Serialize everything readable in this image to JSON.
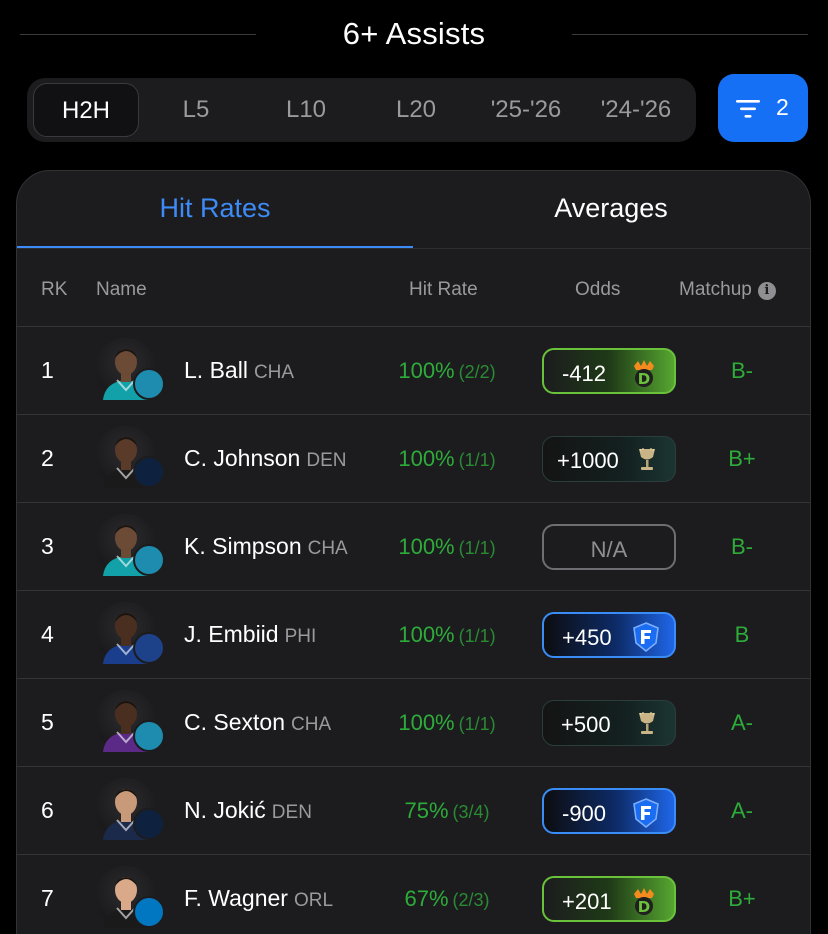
{
  "header": {
    "title": "6+ Assists"
  },
  "periods": [
    {
      "label": "H2H",
      "active": true
    },
    {
      "label": "L5",
      "active": false
    },
    {
      "label": "L10",
      "active": false
    },
    {
      "label": "L20",
      "active": false
    },
    {
      "label": "'25-'26",
      "active": false
    },
    {
      "label": "'24-'26",
      "active": false
    }
  ],
  "filter": {
    "count": "2",
    "icon": "filter-icon"
  },
  "tabs": {
    "hit_rates": "Hit Rates",
    "averages": "Averages",
    "active": "hit_rates"
  },
  "columns": {
    "rk": "RK",
    "name": "Name",
    "hit_rate": "Hit Rate",
    "odds": "Odds",
    "matchup": "Matchup",
    "matchup_icon": "info-icon"
  },
  "colors": {
    "accent": "#1670f5",
    "tab_active": "#3d8bf7",
    "positive": "#2dac3a",
    "draftkings": "#56a631",
    "fanduel": "#1f66e8"
  },
  "players": [
    {
      "rank": "1",
      "name": "L. Ball",
      "team": "CHA",
      "hit_pct": "100%",
      "hit_frac": "(2/2)",
      "odds": "-412",
      "book": "dk",
      "book_icon": "draftkings-icon",
      "matchup": "B-",
      "jersey": "#12a1a8",
      "skin": "#6b4a36",
      "team_color": "#1d8caf"
    },
    {
      "rank": "2",
      "name": "C. Johnson",
      "team": "DEN",
      "hit_pct": "100%",
      "hit_frac": "(1/1)",
      "odds": "+1000",
      "book": "cz",
      "book_icon": "caesars-chalice-icon",
      "matchup": "B+",
      "jersey": "#1a1a1a",
      "skin": "#5a3a28",
      "team_color": "#0e2240"
    },
    {
      "rank": "3",
      "name": "K. Simpson",
      "team": "CHA",
      "hit_pct": "100%",
      "hit_frac": "(1/1)",
      "odds": "N/A",
      "book": "na",
      "book_icon": "",
      "matchup": "B-",
      "jersey": "#12a1a8",
      "skin": "#6b4a36",
      "team_color": "#1d8caf"
    },
    {
      "rank": "4",
      "name": "J. Embiid",
      "team": "PHI",
      "hit_pct": "100%",
      "hit_frac": "(1/1)",
      "odds": "+450",
      "book": "fd",
      "book_icon": "fanduel-icon",
      "matchup": "B",
      "jersey": "#1a3e8c",
      "skin": "#4a2e20",
      "team_color": "#1d428a"
    },
    {
      "rank": "5",
      "name": "C. Sexton",
      "team": "CHA",
      "hit_pct": "100%",
      "hit_frac": "(1/1)",
      "odds": "+500",
      "book": "cz",
      "book_icon": "caesars-chalice-icon",
      "matchup": "A-",
      "jersey": "#5b2a86",
      "skin": "#4a2e20",
      "team_color": "#1d8caf"
    },
    {
      "rank": "6",
      "name": "N. Jokić",
      "team": "DEN",
      "hit_pct": "75%",
      "hit_frac": "(3/4)",
      "odds": "-900",
      "book": "fd",
      "book_icon": "fanduel-icon",
      "matchup": "A-",
      "jersey": "#1b2a4a",
      "skin": "#c89a7a",
      "team_color": "#0e2240"
    },
    {
      "rank": "7",
      "name": "F. Wagner",
      "team": "ORL",
      "hit_pct": "67%",
      "hit_frac": "(2/3)",
      "odds": "+201",
      "book": "dk",
      "book_icon": "draftkings-icon",
      "matchup": "B+",
      "jersey": "#1a1a1a",
      "skin": "#d9a98a",
      "team_color": "#0077c0"
    }
  ]
}
